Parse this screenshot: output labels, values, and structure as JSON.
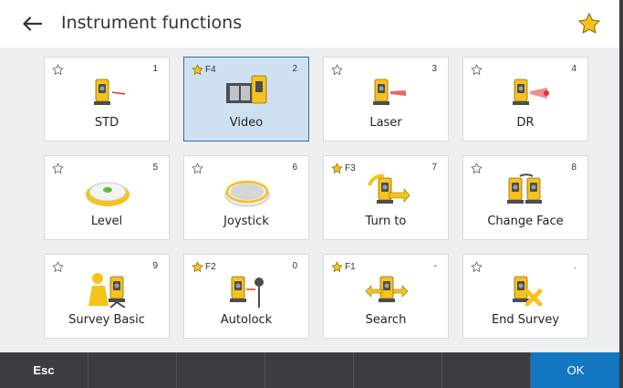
{
  "header": {
    "title": "Instrument functions",
    "back_icon": "arrow-left-icon",
    "favorites_icon": "star-filled-icon"
  },
  "colors": {
    "accent": "#1276c2",
    "star_yellow": "#f7c21b",
    "selected_bg": "#cfe1f1",
    "footer_bg": "#3a3d42"
  },
  "tiles": [
    {
      "label": "STD",
      "number": "1",
      "shortcut": "",
      "favorite": false,
      "selected": false,
      "icon": "total-station-std-icon"
    },
    {
      "label": "Video",
      "number": "2",
      "shortcut": "F4",
      "favorite": true,
      "selected": true,
      "icon": "video-filmstrip-icon"
    },
    {
      "label": "Laser",
      "number": "3",
      "shortcut": "",
      "favorite": false,
      "selected": false,
      "icon": "total-station-laser-icon"
    },
    {
      "label": "DR",
      "number": "4",
      "shortcut": "",
      "favorite": false,
      "selected": false,
      "icon": "total-station-dr-icon"
    },
    {
      "label": "Level",
      "number": "5",
      "shortcut": "",
      "favorite": false,
      "selected": false,
      "icon": "level-bubble-icon"
    },
    {
      "label": "Joystick",
      "number": "6",
      "shortcut": "",
      "favorite": false,
      "selected": false,
      "icon": "joystick-disc-icon"
    },
    {
      "label": "Turn to",
      "number": "7",
      "shortcut": "F3",
      "favorite": true,
      "selected": false,
      "icon": "turn-to-icon"
    },
    {
      "label": "Change Face",
      "number": "8",
      "shortcut": "",
      "favorite": false,
      "selected": false,
      "icon": "change-face-icon"
    },
    {
      "label": "Survey Basic",
      "number": "9",
      "shortcut": "",
      "favorite": false,
      "selected": false,
      "icon": "survey-basic-icon"
    },
    {
      "label": "Autolock",
      "number": "0",
      "shortcut": "F2",
      "favorite": true,
      "selected": false,
      "icon": "autolock-prism-icon"
    },
    {
      "label": "Search",
      "number": "-",
      "shortcut": "F1",
      "favorite": true,
      "selected": false,
      "icon": "search-arrows-icon"
    },
    {
      "label": "End Survey",
      "number": ".",
      "shortcut": "",
      "favorite": false,
      "selected": false,
      "icon": "end-survey-icon"
    }
  ],
  "footer": {
    "esc_label": "Esc",
    "ok_label": "OK"
  }
}
